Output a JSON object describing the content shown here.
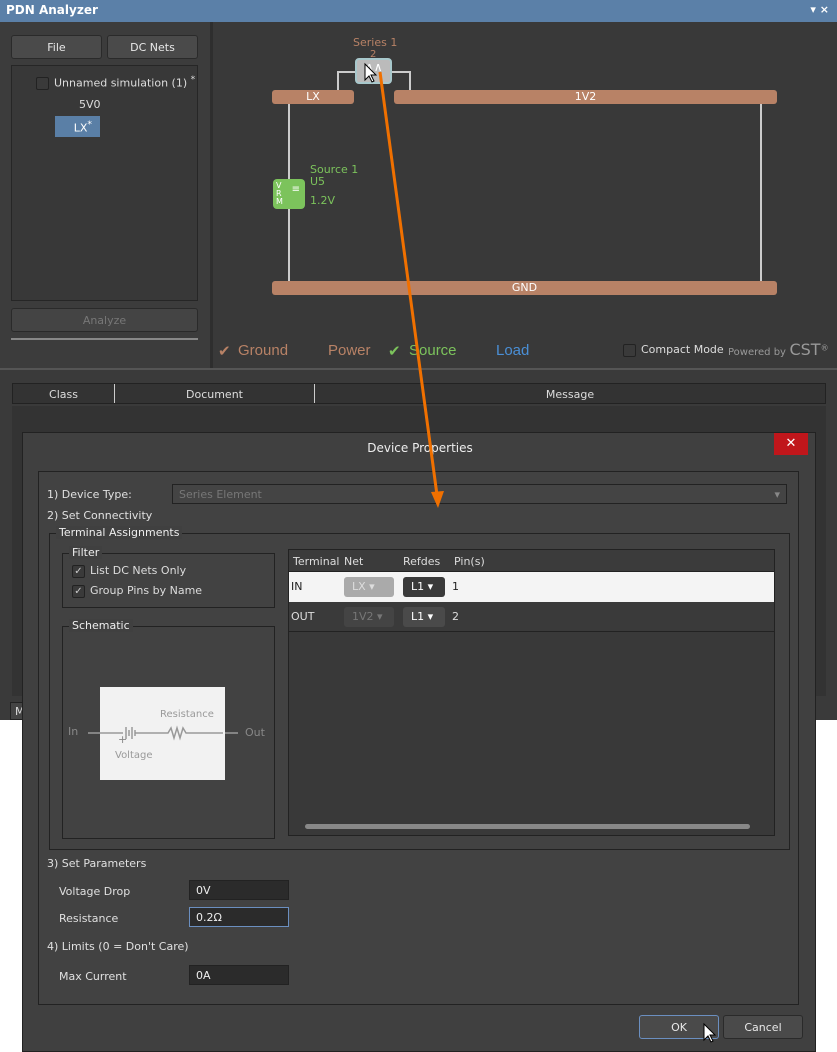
{
  "window": {
    "title": "PDN Analyzer",
    "controls": "▾ ×"
  },
  "left": {
    "file": "File",
    "dc_nets": "DC Nets",
    "simulation": "Unnamed simulation (1)",
    "sim_mark": "*",
    "nets": [
      "5V0",
      "LX"
    ],
    "selected_mark": "*",
    "analyze": "Analyze"
  },
  "diagram": {
    "series_label": "Series 1",
    "series_ref": "2",
    "nets": {
      "lx": "LX",
      "v12": "1V2",
      "gnd": "GND"
    },
    "source_label": "Source 1",
    "source_ref": "U5",
    "source_voltage": "1.2V",
    "vrm": "VRM"
  },
  "legend": {
    "check": "✔",
    "ground": "Ground",
    "power": "Power",
    "source": "Source",
    "load": "Load",
    "compact": "Compact Mode",
    "powered": "Powered by",
    "brand": "CST",
    "reg": "®"
  },
  "colors": {
    "title": "#5b80a8",
    "net": "#b88266",
    "source": "#7cc35c",
    "load": "#4a8fd6",
    "close": "#c0161b",
    "arrow": "#f07000"
  },
  "messages": {
    "columns": [
      "Class",
      "Document",
      "Message"
    ],
    "tab": "M"
  },
  "dialog": {
    "title": "Device Properties",
    "close": "✕",
    "device_type_label": "1) Device Type:",
    "device_type": "Series Element",
    "connectivity": "2) Set Connectivity",
    "terminal_assignments": "Terminal Assignments",
    "filter": "Filter",
    "list_dc": "List DC Nets Only",
    "group_pins": "Group Pins by Name",
    "schematic": "Schematic",
    "sch": {
      "in": "In",
      "out": "Out",
      "resistance": "Resistance",
      "voltage": "Voltage",
      "plus": "+"
    },
    "table": {
      "headers": [
        "Terminal",
        "Net",
        "Refdes",
        "Pin(s)"
      ],
      "rows": [
        {
          "terminal": "IN",
          "net": "LX",
          "refdes": "L1",
          "pins": "1"
        },
        {
          "terminal": "OUT",
          "net": "1V2",
          "refdes": "L1",
          "pins": "2"
        }
      ]
    },
    "params": "3) Set Parameters",
    "voltage_drop_label": "Voltage Drop",
    "voltage_drop": "0V",
    "resistance_label": "Resistance",
    "resistance": "0.2Ω",
    "limits": "4) Limits (0 = Don't Care)",
    "max_current_label": "Max Current",
    "max_current": "0A",
    "ok": "OK",
    "cancel": "Cancel"
  }
}
